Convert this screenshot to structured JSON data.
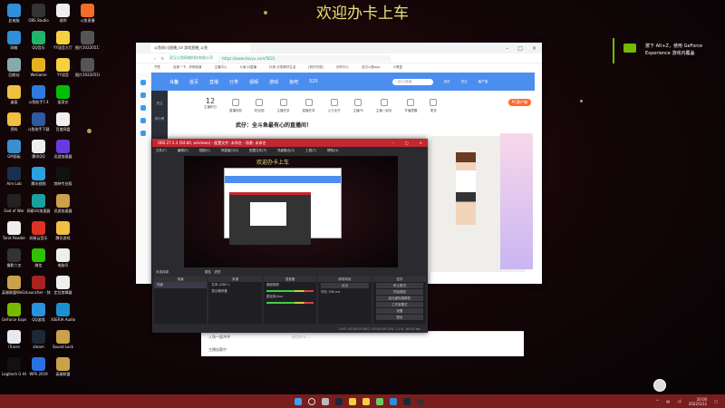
{
  "banner": "欢迎办卡上车",
  "desktop_icons": [
    [
      "此电脑",
      "#2f8fd8"
    ],
    [
      "网络",
      "#2f8fd8"
    ],
    [
      "回收站",
      "#8aa"
    ],
    [
      "桌面",
      "#f0c040"
    ],
    [
      "资料",
      "#f0c040"
    ],
    [
      "GM面板",
      "#3a8fd0"
    ],
    [
      "Aim Lab",
      "#1a3050"
    ],
    [
      "God of War",
      "#222"
    ],
    [
      "Tarot Reader",
      "#eee"
    ],
    [
      "摄影六叉",
      "#333"
    ],
    [
      "英雄联盟WeGame版",
      "#c9a24a"
    ],
    [
      "GeForce Experience",
      "#76b900"
    ],
    [
      "iTunes",
      "#e8e8f0"
    ],
    [
      "Logitech G HUB",
      "#111"
    ],
    [
      "OBS Studio",
      "#333"
    ],
    [
      "QQ音乐",
      "#1fb56a"
    ],
    [
      "WeGame",
      "#e6b020"
    ],
    [
      "斗鱼助手7.4",
      "#2e7ae0"
    ],
    [
      "斗鱼助手下载",
      "#2e5aa0"
    ],
    [
      "腾讯QQ",
      "#eee"
    ],
    [
      "腾讯视频",
      "#2aa0e0"
    ],
    [
      "网易UU加速器",
      "#1aa0a0"
    ],
    [
      "网易云音乐",
      "#d32"
    ],
    [
      "微信",
      "#2dc100"
    ],
    [
      "Launcher - 快捷方式",
      "#a22"
    ],
    [
      "QQ游戏",
      "#2a90e0"
    ],
    [
      "steam",
      "#1b2838"
    ],
    [
      "WPS 2019",
      "#2a70e0"
    ],
    [
      "说明",
      "#eee"
    ],
    [
      "YY语音大厅",
      "#f5d040"
    ],
    [
      "YY语音",
      "#f5d040"
    ],
    [
      "爱奇艺",
      "#00be06"
    ],
    [
      "百度网盘",
      "#eee"
    ],
    [
      "迅游加速器",
      "#6a3ae0"
    ],
    [
      "剪映专业版",
      "#111"
    ],
    [
      "迅游加速器",
      "#c9a24a"
    ],
    [
      "腾讯游戏",
      "#f0c040"
    ],
    [
      "电脑号",
      "#eee"
    ],
    [
      "定位剪辑器",
      "#eee"
    ],
    [
      "XSERIA Audio",
      "#1a90d0"
    ],
    [
      "Sound Lock",
      "#c9a24a"
    ],
    [
      "英雄联盟",
      "#c9a24a"
    ],
    [
      "斗鱼直播",
      "#f26c2a"
    ],
    [
      "图片20220511",
      "#555"
    ],
    [
      "图片20220510",
      "#555"
    ]
  ],
  "nvidia": {
    "line1": "按下 Alt+Z，使用 GeForce",
    "line2": "Experience 游戏内覆盖"
  },
  "browser": {
    "tab": "斗鱼网小J直播_lol 游戏直播_斗鱼",
    "url": "https://www.douyu.com/5621",
    "site_label": "武汉斗鱼网络科技有限公司",
    "bookmarks": [
      "书签",
      "百度一下，你就知道",
      "主播中心",
      "斗鱼小J直播",
      "抖音-记录美好生活",
      "[知识付费]",
      "创作中心",
      "武汉斗鱼app",
      "小黑盒"
    ],
    "nav": [
      "首页",
      "直播",
      "分类",
      "视频",
      "游戏",
      "鱼吧",
      "520"
    ],
    "search_placeholder": "一起小J直播",
    "nav_right": [
      "历史",
      "关注",
      "客户端"
    ],
    "side": [
      "关注",
      "排行榜"
    ],
    "tools": [
      "主播积分",
      "直播特权",
      "粉丝团",
      "主播任务",
      "直播任务",
      "火力全开",
      "主播PK",
      "主播一起玩",
      "开播提醒",
      "更多"
    ],
    "score": "12",
    "pc_button": "PC客户端",
    "live_title": "武仔：全斗鱼最有心的直播间！",
    "chat_hint": "一起小J直播",
    "chat_input": "说点什么...",
    "chat_items": [
      "入场一起冲冲",
      "主播加载中"
    ]
  },
  "obs": {
    "title": "OBS 27.2.3 (64-bit, windows) - 配置文件: 未命名 - 场景: 未命名",
    "menu": [
      "文件(F)",
      "编辑(E)",
      "视图(V)",
      "停靠窗口(D)",
      "配置文件(P)",
      "场景集合(S)",
      "工具(T)",
      "帮助(H)"
    ],
    "no_source": "未选择源",
    "props": "属性",
    "filters": "滤镜",
    "docks": {
      "scenes": "场景",
      "sources": "来源",
      "mixer": "混音器",
      "transitions": "转场特效",
      "controls": "控件"
    },
    "scene_items": [
      "场景"
    ],
    "source_items": [
      "文本 (GDI+)",
      "显示器采集"
    ],
    "mixer_items": [
      "桌面音频",
      "麦克风/Aux"
    ],
    "transition": "淡出",
    "duration_label": "时长",
    "duration": "300 ms",
    "controls": [
      "停止推流",
      "开始录制",
      "启动虚拟摄像机",
      "工作室模式",
      "设置",
      "退出"
    ],
    "status": "LIVE: 00:00:00   REC: 00:00:00   CPU: 1.1%, 60.00 fps"
  },
  "tray": {
    "time": "20:00",
    "date": "2022/5/11"
  }
}
